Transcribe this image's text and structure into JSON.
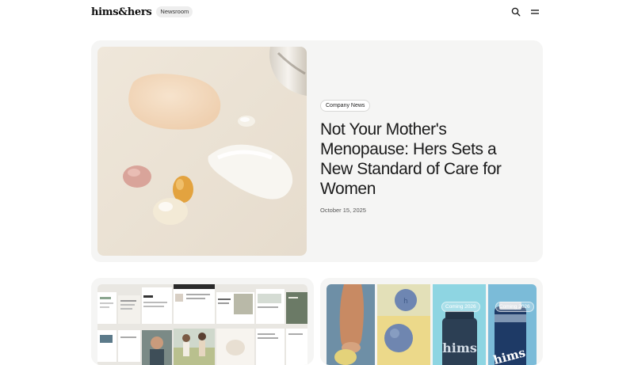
{
  "header": {
    "logo": "hims&hers",
    "section_label": "Newsroom",
    "icons": [
      "search-icon",
      "menu-icon"
    ]
  },
  "featured": {
    "tag": "Company News",
    "title": "Not Your Mother's Menopause: Hers Sets a New Standard of Care for Women",
    "date": "October 15, 2025"
  },
  "cards": {
    "right": {
      "badges": [
        "Coming 2026",
        "Coming 2026"
      ],
      "bottle_labels": [
        "hims",
        "hims"
      ]
    }
  },
  "colors": {
    "card_bg": "#f5f5f4",
    "text": "#1b1b1b"
  }
}
